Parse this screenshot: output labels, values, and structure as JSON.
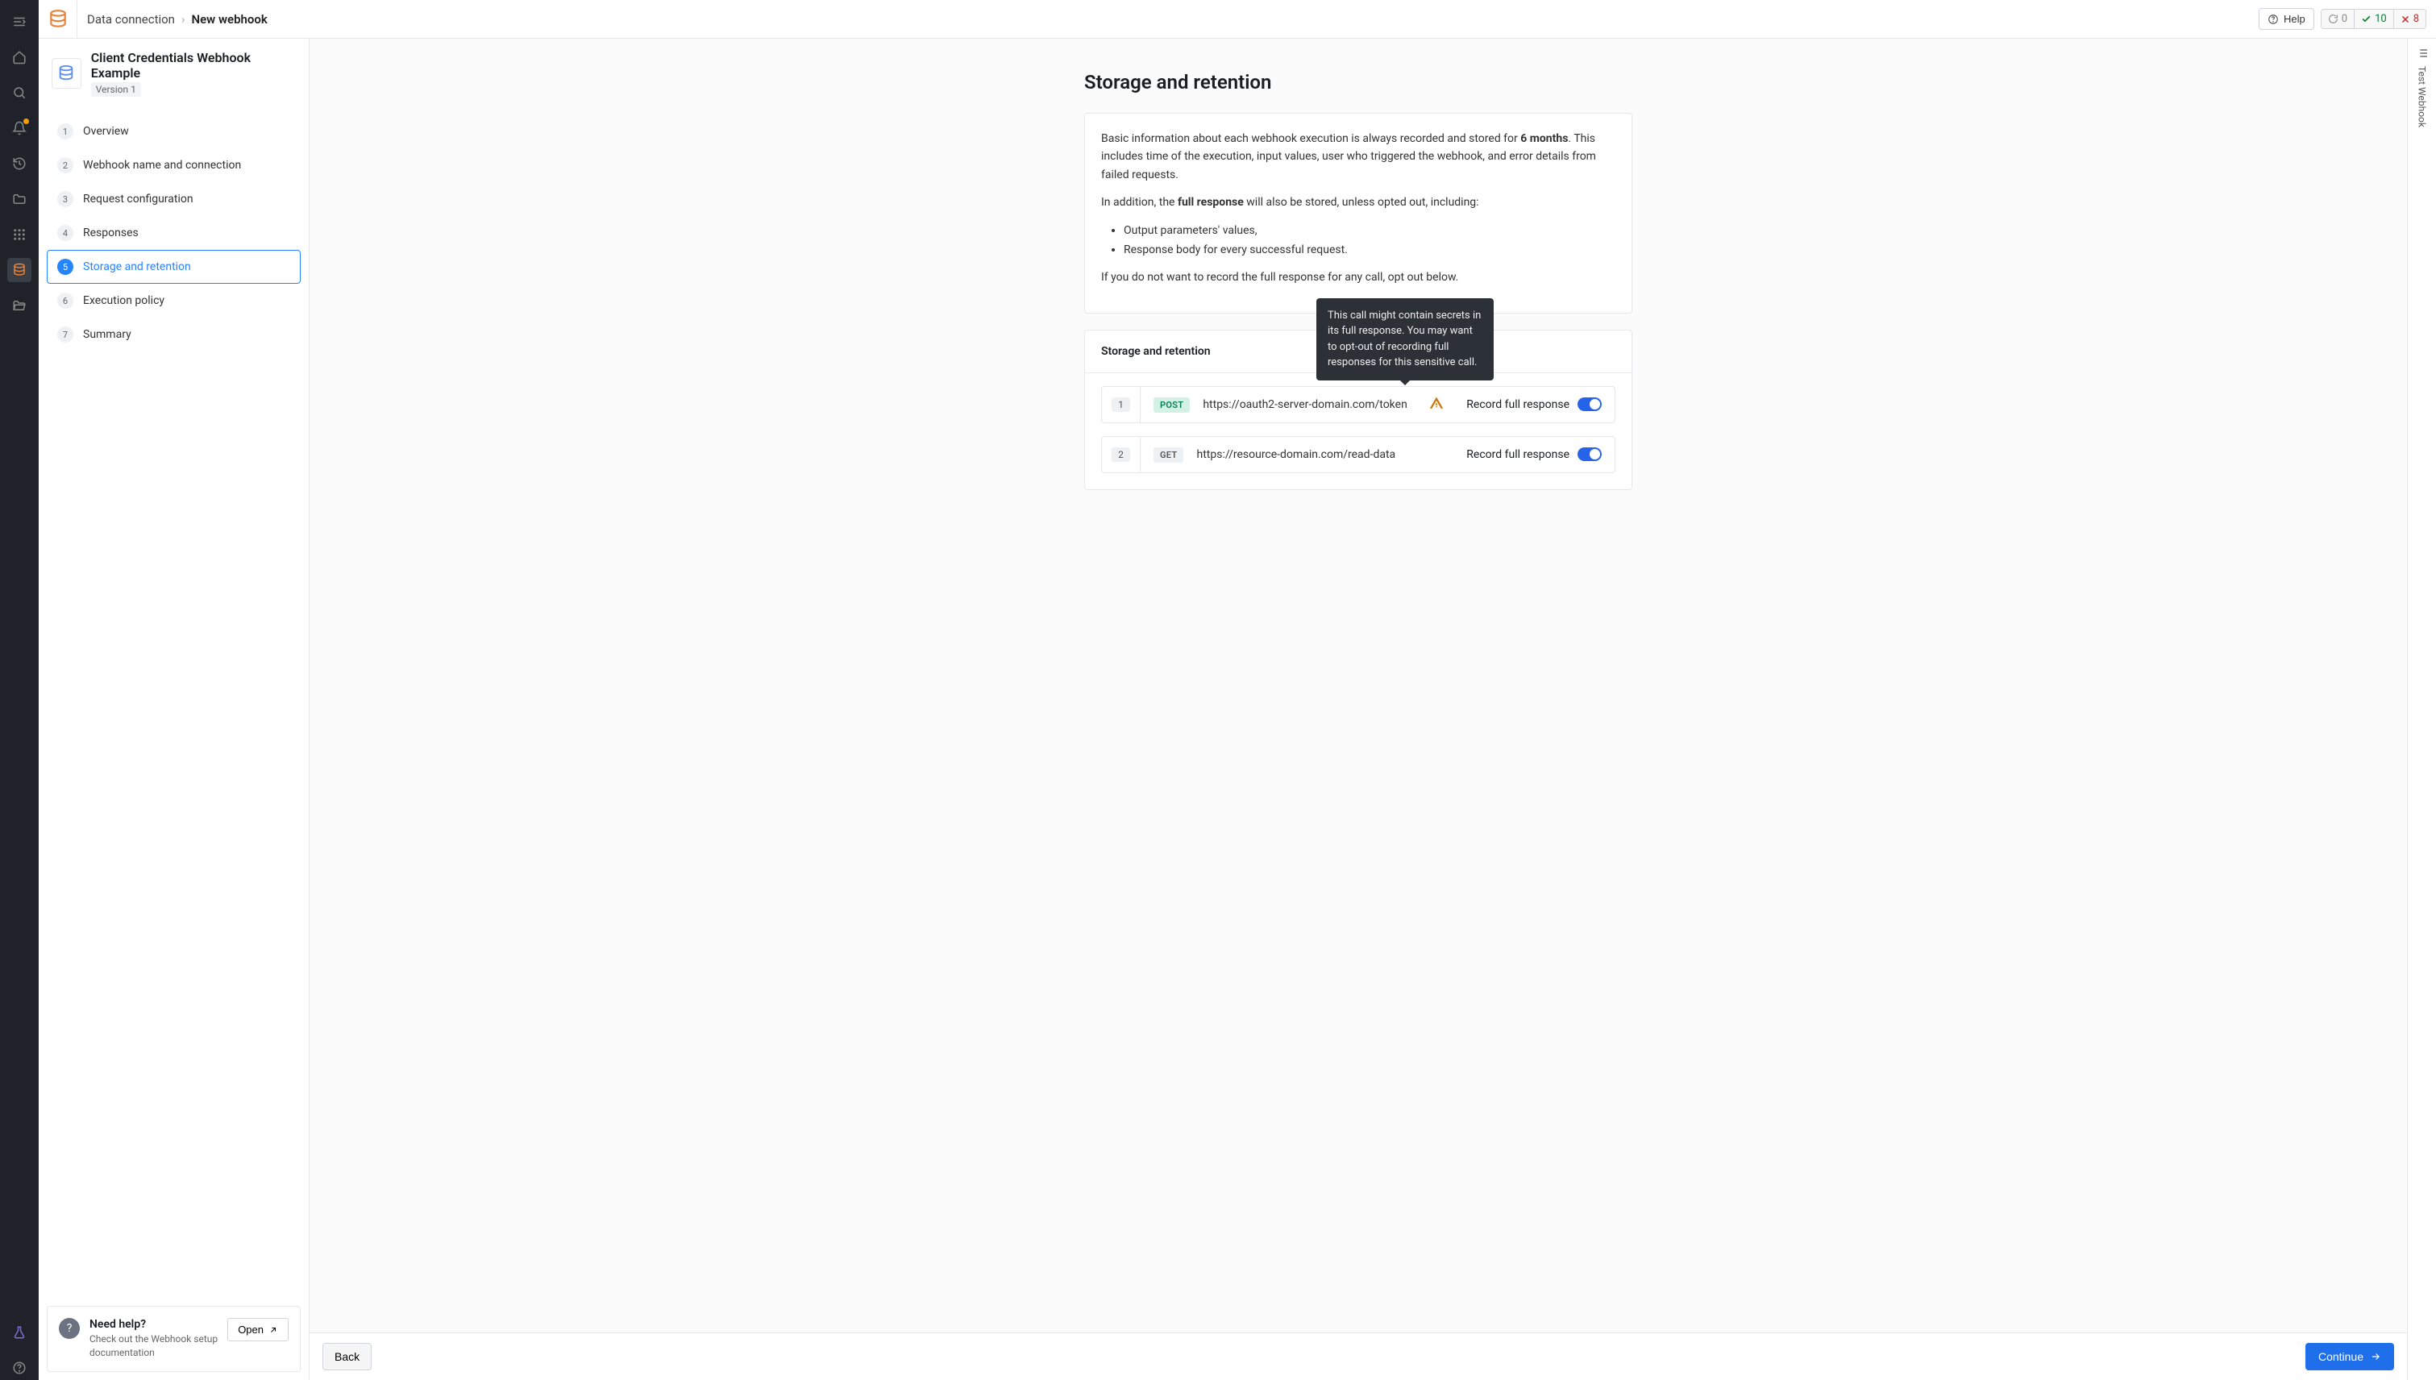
{
  "breadcrumb": {
    "root": "Data connection",
    "current": "New webhook"
  },
  "topbar": {
    "help": "Help",
    "status": {
      "pending": "0",
      "ok": "10",
      "err": "8"
    }
  },
  "sidebar": {
    "title": "Client Credentials Webhook Example",
    "version": "Version 1",
    "steps": [
      {
        "n": "1",
        "label": "Overview"
      },
      {
        "n": "2",
        "label": "Webhook name and connection"
      },
      {
        "n": "3",
        "label": "Request configuration"
      },
      {
        "n": "4",
        "label": "Responses"
      },
      {
        "n": "5",
        "label": "Storage and retention"
      },
      {
        "n": "6",
        "label": "Execution policy"
      },
      {
        "n": "7",
        "label": "Summary"
      }
    ],
    "help": {
      "title": "Need help?",
      "desc": "Check out the Webhook setup documentation",
      "open": "Open"
    }
  },
  "page": {
    "heading": "Storage and retention",
    "info": {
      "p1_a": "Basic information about each webhook execution is always recorded and stored for ",
      "p1_b": "6 months",
      "p1_c": ". This includes time of the execution, input values, user who triggered the webhook, and error details from failed requests.",
      "p2_a": "In addition, the ",
      "p2_b": "full response",
      "p2_c": " will also be stored, unless opted out, including:",
      "li1": "Output parameters' values,",
      "li2": "Response body for every successful request.",
      "p3": "If you do not want to record the full response for any call, opt out below."
    },
    "section_title": "Storage and retention",
    "requests": [
      {
        "n": "1",
        "method": "POST",
        "url": "https://oauth2-server-domain.com/token",
        "warn": true,
        "toggle_label": "Record full response"
      },
      {
        "n": "2",
        "method": "GET",
        "url": "https://resource-domain.com/read-data",
        "warn": false,
        "toggle_label": "Record full response"
      }
    ],
    "tooltip": "This call might contain secrets in its full response. You may want to opt-out of recording full responses for this sensitive call.",
    "back": "Back",
    "continue": "Continue"
  },
  "test_rail": {
    "label": "Test Webhook"
  }
}
